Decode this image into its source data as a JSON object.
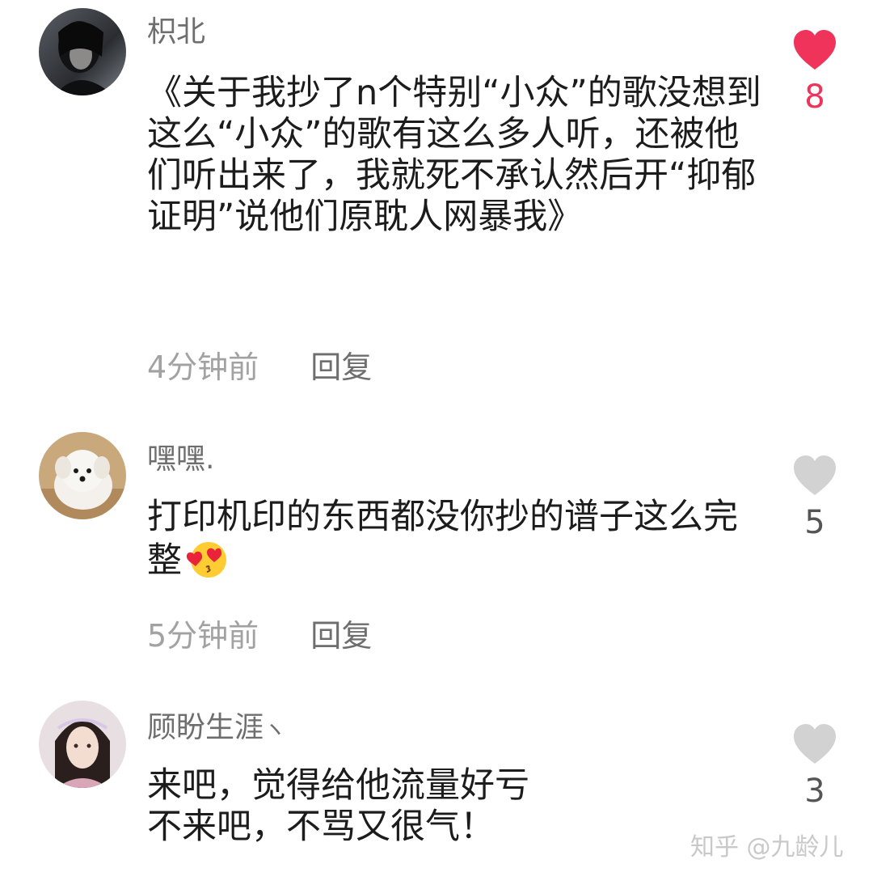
{
  "comments": [
    {
      "username": "枳北",
      "text": "《关于我抄了n个特别“小众”的歌没想到这么“小众”的歌有这么多人听，还被他们听出来了，我就死不承认然后开“抑郁证明”说他们原耽人网暴我》",
      "time": "4分钟前",
      "reply_label": "回复",
      "likes": "8",
      "liked": true,
      "avatar_icon": "dark-portrait-avatar"
    },
    {
      "username": "嘿嘿.",
      "text": "打印机印的东西都没你抄的谱子这么完整",
      "emoji": "heart-eyes-kiss-emoji",
      "time": "5分钟前",
      "reply_label": "回复",
      "likes": "5",
      "liked": false,
      "avatar_icon": "white-puppy-avatar"
    },
    {
      "username": "顾盼生涯",
      "username_suffix": "ヽ",
      "text": "来吧，觉得给他流量好亏\n不来吧，不骂又很气！",
      "likes": "3",
      "liked": false,
      "avatar_icon": "anime-character-avatar"
    }
  ],
  "watermark": "知乎 @九龄儿",
  "colors": {
    "liked_heart": "#f0335a",
    "unliked_heart": "#d2d2d2",
    "username": "#6e6e6e",
    "timestamp": "#a2a2a2"
  }
}
